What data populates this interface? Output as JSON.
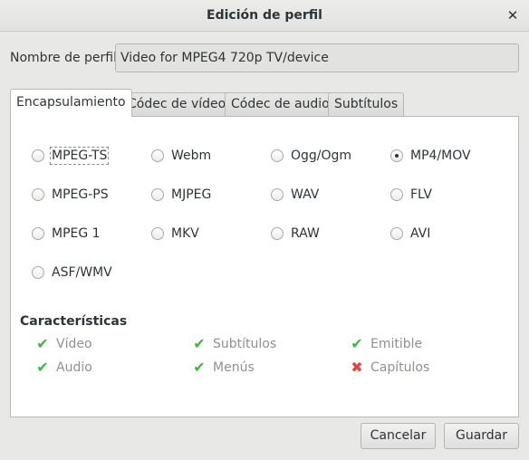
{
  "window": {
    "title": "Edición de perfil"
  },
  "profile": {
    "label": "Nombre de perfil",
    "value": "Video for MPEG4 720p TV/device"
  },
  "tabs": [
    "Encapsulamiento",
    "Códec de vídeo",
    "Códec de audio",
    "Subtítulos"
  ],
  "containers": [
    {
      "label": "MPEG-TS",
      "checked": false
    },
    {
      "label": "Webm",
      "checked": false
    },
    {
      "label": "Ogg/Ogm",
      "checked": false
    },
    {
      "label": "MP4/MOV",
      "checked": true
    },
    {
      "label": "MPEG-PS",
      "checked": false
    },
    {
      "label": "MJPEG",
      "checked": false
    },
    {
      "label": "WAV",
      "checked": false
    },
    {
      "label": "FLV",
      "checked": false
    },
    {
      "label": "MPEG 1",
      "checked": false
    },
    {
      "label": "MKV",
      "checked": false
    },
    {
      "label": "RAW",
      "checked": false
    },
    {
      "label": "AVI",
      "checked": false
    },
    {
      "label": "ASF/WMV",
      "checked": false
    }
  ],
  "features": {
    "title": "Características",
    "items": [
      {
        "label": "Vídeo",
        "supported": true
      },
      {
        "label": "Subtítulos",
        "supported": true
      },
      {
        "label": "Emitible",
        "supported": true
      },
      {
        "label": "Audio",
        "supported": true
      },
      {
        "label": "Menús",
        "supported": true
      },
      {
        "label": "Capítulos",
        "supported": false
      }
    ]
  },
  "buttons": {
    "cancel": "Cancelar",
    "save": "Guardar"
  },
  "icons": {
    "close": "close-icon",
    "supported": "check-icon",
    "unsupported": "cross-icon"
  },
  "colors": {
    "check": "#3cb93c",
    "cross": "#e0443e",
    "disabled_text": "#8f918c"
  }
}
